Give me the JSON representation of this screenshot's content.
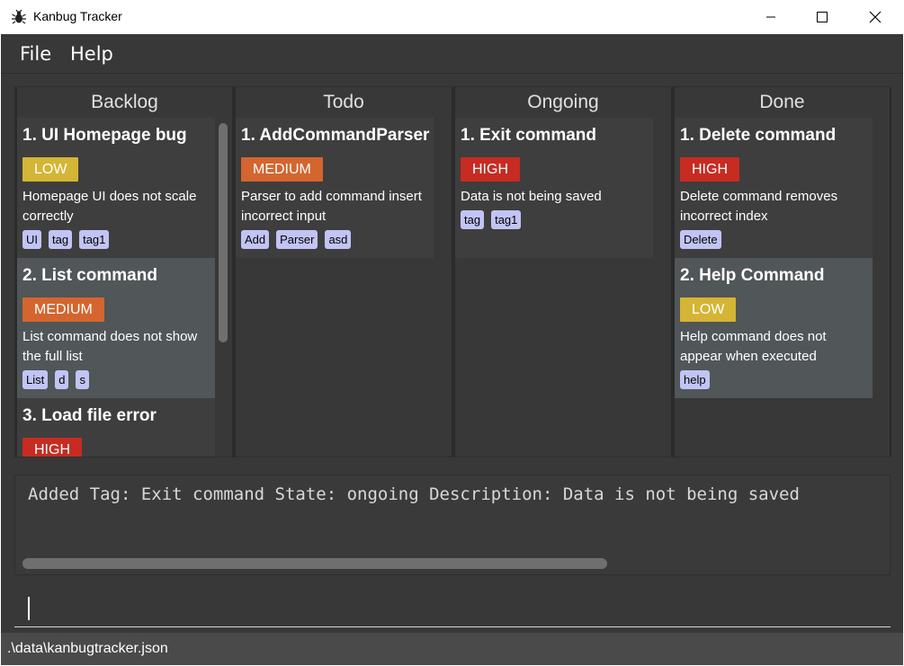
{
  "window": {
    "title": "Kanbug Tracker",
    "icon": "bug-icon"
  },
  "menu": [
    {
      "label": "File"
    },
    {
      "label": "Help"
    }
  ],
  "colors": {
    "low": "#d4b535",
    "medium": "#d4652e",
    "high": "#c72b22",
    "tag_bg": "#c1c4f5",
    "panel": "#383838"
  },
  "columns": [
    {
      "title": "Backlog",
      "cards": [
        {
          "title": "1. UI Homepage bug",
          "priority": "LOW",
          "description": "Homepage UI does not scale correctly",
          "tags": [
            "UI",
            "tag",
            "tag1"
          ]
        },
        {
          "title": "2. List command",
          "priority": "MEDIUM",
          "description": "List command does not show the full list",
          "tags": [
            "List",
            "d",
            "s"
          ]
        },
        {
          "title": "3. Load file error",
          "priority": "HIGH",
          "description": "",
          "tags": []
        }
      ]
    },
    {
      "title": "Todo",
      "cards": [
        {
          "title": "1. AddCommandParser",
          "priority": "MEDIUM",
          "description": "Parser to add command insert incorrect input",
          "tags": [
            "Add",
            "Parser",
            "asd"
          ]
        }
      ]
    },
    {
      "title": "Ongoing",
      "cards": [
        {
          "title": "1. Exit command",
          "priority": "HIGH",
          "description": "Data is not being saved",
          "tags": [
            "tag",
            "tag1"
          ]
        }
      ]
    },
    {
      "title": "Done",
      "cards": [
        {
          "title": "1. Delete command",
          "priority": "HIGH",
          "description": "Delete command removes incorrect index",
          "tags": [
            "Delete"
          ]
        },
        {
          "title": "2. Help Command",
          "priority": "LOW",
          "description": "Help command does not appear when executed",
          "tags": [
            "help"
          ]
        }
      ]
    }
  ],
  "result_text": "Added Tag: Exit command State: ongoing Description: Data is not being saved",
  "command_input": {
    "value": ""
  },
  "status_bar": {
    "path": ".\\data\\kanbugtracker.json"
  }
}
